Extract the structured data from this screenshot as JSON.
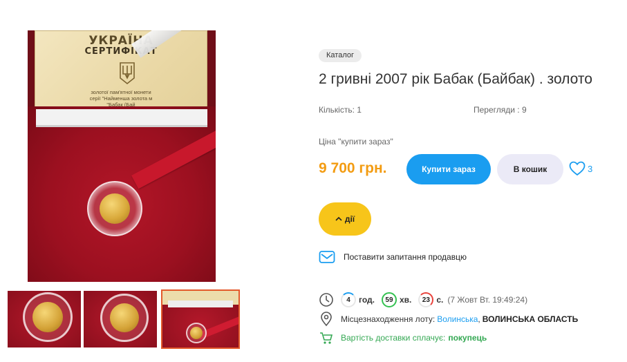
{
  "gallery": {
    "main_photo_alt": "",
    "certificate": {
      "line1": "УКРАЇНА",
      "line2": "СЕРТИФІКАТ",
      "line3": "золотої пам'ятної монети",
      "line4": "серії \"Найменша золота м",
      "line5": "\"Бабак (Бай"
    },
    "thumbnails": [
      {
        "selected": false
      },
      {
        "selected": false
      },
      {
        "selected": true
      }
    ]
  },
  "lot": {
    "category_chip": "Каталог",
    "title": "2 гривні 2007 рік Бабак (Байбак) . золото",
    "quantity_label": "Кількість:",
    "quantity_value": "1",
    "views_label": "Перегляди :",
    "views_value": "9",
    "price_label": "Ціна \"купити зараз\"",
    "price": "9 700 грн.",
    "buy_now_label": "Купити зараз",
    "to_cart_label": "В кошик",
    "favorites_count": "3",
    "actions_label": "дії",
    "ask_seller_label": "Поставити запитання продавцю"
  },
  "timer": {
    "hours": "4",
    "hours_unit": "год.",
    "minutes": "59",
    "minutes_unit": "хв.",
    "seconds": "23",
    "seconds_unit": "с.",
    "end_date": "(7 Жовт Вт. 19:49:24)"
  },
  "location": {
    "label": "Місцезнаходження лоту:",
    "city": "Волинська",
    "separator": ",",
    "region": "ВОЛИНСЬКА ОБЛАСТЬ"
  },
  "delivery": {
    "label": "Вартість доставки сплачує:",
    "payer": "покупець"
  },
  "colors": {
    "accent_blue": "#1a9df0",
    "price_orange": "#f39c12",
    "actions_yellow": "#f7c51a",
    "delivery_green": "#34a853"
  }
}
